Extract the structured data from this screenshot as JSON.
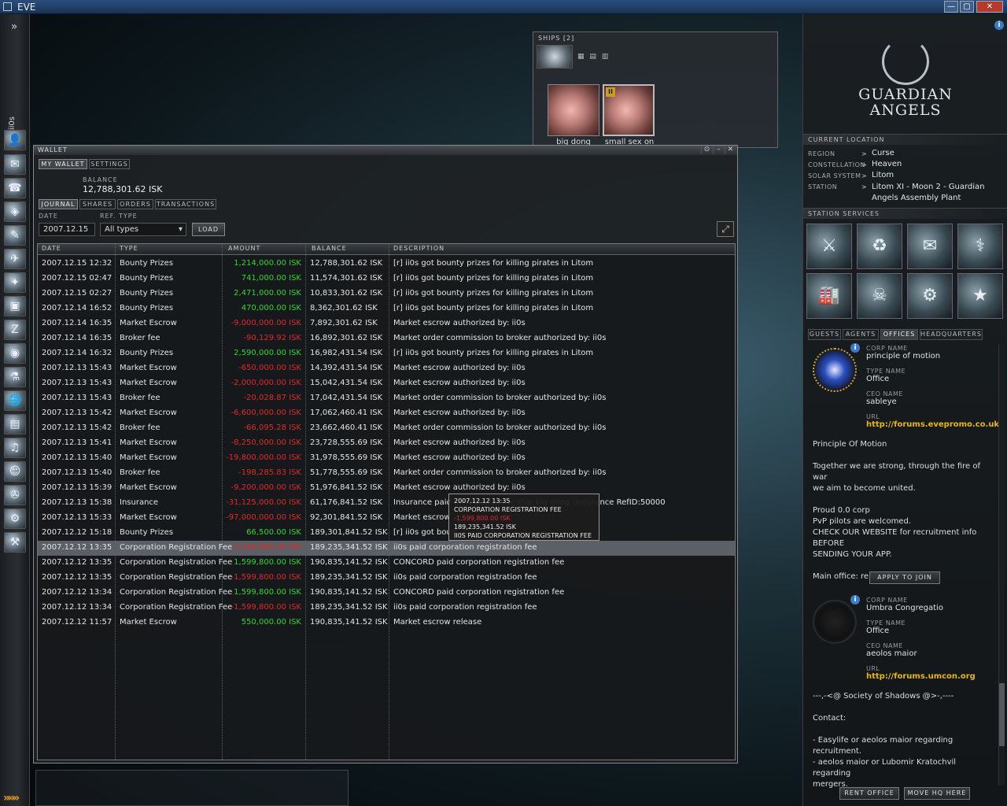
{
  "window": {
    "title": "EVE",
    "min": "—",
    "max": "▢",
    "close": "✕"
  },
  "neocom": {
    "expand_label": "»",
    "username": "ii0s",
    "items": [
      "👤",
      "✉",
      "☎",
      "◈",
      "✎",
      "✈",
      "✦",
      "▣",
      "Z",
      "◉",
      "⚗",
      "🌐",
      "▤",
      "♫",
      "☺",
      "✇",
      "⚙",
      "⚒"
    ],
    "bottom": "»»»"
  },
  "ships": {
    "header": "SHIPS [2]",
    "view_icons": "▦ ▤ ▥",
    "items": [
      {
        "name": "big dong",
        "tag": ""
      },
      {
        "name": "small sex on",
        "tag": "II"
      }
    ]
  },
  "wallet": {
    "title": "WALLET",
    "top_tabs": [
      "MY WALLET",
      "SETTINGS"
    ],
    "balance_label": "BALANCE",
    "balance": "12,788,301.62 ISK",
    "sub_tabs": [
      "JOURNAL",
      "SHARES",
      "ORDERS",
      "TRANSACTIONS"
    ],
    "date_label": "DATE",
    "reftype_label": "REF. TYPE",
    "date_value": "2007.12.15",
    "reftype_value": "All types",
    "load_label": "LOAD",
    "export_icon": "⤢",
    "columns": [
      "DATE",
      "TYPE",
      "AMOUNT",
      "BALANCE",
      "DESCRIPTION"
    ],
    "rows": [
      {
        "date": "2007.12.15 12:32",
        "type": "Bounty Prizes",
        "amount": "1,214,000.00 ISK",
        "sign": "pos",
        "balance": "12,788,301.62 ISK",
        "desc": "[r] ii0s got bounty prizes for killing pirates in Litom"
      },
      {
        "date": "2007.12.15 02:47",
        "type": "Bounty Prizes",
        "amount": "741,000.00 ISK",
        "sign": "pos",
        "balance": "11,574,301.62 ISK",
        "desc": "[r] ii0s got bounty prizes for killing pirates in Litom"
      },
      {
        "date": "2007.12.15 02:27",
        "type": "Bounty Prizes",
        "amount": "2,471,000.00 ISK",
        "sign": "pos",
        "balance": "10,833,301.62 ISK",
        "desc": "[r] ii0s got bounty prizes for killing pirates in Litom"
      },
      {
        "date": "2007.12.14 16:52",
        "type": "Bounty Prizes",
        "amount": "470,000.00 ISK",
        "sign": "pos",
        "balance": "8,362,301.62 ISK",
        "desc": "[r] ii0s got bounty prizes for killing pirates in Litom"
      },
      {
        "date": "2007.12.14 16:35",
        "type": "Market Escrow",
        "amount": "-9,000,000.00 ISK",
        "sign": "neg",
        "balance": "7,892,301.62 ISK",
        "desc": "Market escrow authorized by: ii0s"
      },
      {
        "date": "2007.12.14 16:35",
        "type": "Broker fee",
        "amount": "-90,129.92 ISK",
        "sign": "neg",
        "balance": "16,892,301.62 ISK",
        "desc": "Market order commission to broker authorized by: ii0s"
      },
      {
        "date": "2007.12.14 16:32",
        "type": "Bounty Prizes",
        "amount": "2,590,000.00 ISK",
        "sign": "pos",
        "balance": "16,982,431.54 ISK",
        "desc": "[r] ii0s got bounty prizes for killing pirates in Litom"
      },
      {
        "date": "2007.12.13 15:43",
        "type": "Market Escrow",
        "amount": "-650,000.00 ISK",
        "sign": "neg",
        "balance": "14,392,431.54 ISK",
        "desc": "Market escrow authorized by: ii0s"
      },
      {
        "date": "2007.12.13 15:43",
        "type": "Market Escrow",
        "amount": "-2,000,000.00 ISK",
        "sign": "neg",
        "balance": "15,042,431.54 ISK",
        "desc": "Market escrow authorized by: ii0s"
      },
      {
        "date": "2007.12.13 15:43",
        "type": "Broker fee",
        "amount": "-20,028.87 ISK",
        "sign": "neg",
        "balance": "17,042,431.54 ISK",
        "desc": "Market order commission to broker authorized by: ii0s"
      },
      {
        "date": "2007.12.13 15:42",
        "type": "Market Escrow",
        "amount": "-6,600,000.00 ISK",
        "sign": "neg",
        "balance": "17,062,460.41 ISK",
        "desc": "Market escrow authorized by: ii0s"
      },
      {
        "date": "2007.12.13 15:42",
        "type": "Broker fee",
        "amount": "-66,095.28 ISK",
        "sign": "neg",
        "balance": "23,662,460.41 ISK",
        "desc": "Market order commission to broker authorized by: ii0s"
      },
      {
        "date": "2007.12.13 15:41",
        "type": "Market Escrow",
        "amount": "-8,250,000.00 ISK",
        "sign": "neg",
        "balance": "23,728,555.69 ISK",
        "desc": "Market escrow authorized by: ii0s"
      },
      {
        "date": "2007.12.13 15:40",
        "type": "Market Escrow",
        "amount": "-19,800,000.00 ISK",
        "sign": "neg",
        "balance": "31,978,555.69 ISK",
        "desc": "Market escrow authorized by: ii0s"
      },
      {
        "date": "2007.12.13 15:40",
        "type": "Broker fee",
        "amount": "-198,285.83 ISK",
        "sign": "neg",
        "balance": "51,778,555.69 ISK",
        "desc": "Market order commission to broker authorized by: ii0s"
      },
      {
        "date": "2007.12.13 15:39",
        "type": "Market Escrow",
        "amount": "-9,200,000.00 ISK",
        "sign": "neg",
        "balance": "51,976,841.52 ISK",
        "desc": "Market escrow authorized by: ii0s"
      },
      {
        "date": "2007.12.13 15:38",
        "type": "Insurance",
        "amount": "-31,125,000.00 ISK",
        "sign": "neg",
        "balance": "61,176,841.52 ISK",
        "desc": "Insurance paid                                                  commission for ship big dong (Insurance RefID:50000"
      },
      {
        "date": "2007.12.13 15:33",
        "type": "Market Escrow",
        "amount": "-97,000,000.00 ISK",
        "sign": "neg",
        "balance": "92,301,841.52 ISK",
        "desc": "Market escrow"
      },
      {
        "date": "2007.12.12 15:18",
        "type": "Bounty Prizes",
        "amount": "66,500.00 ISK",
        "sign": "pos",
        "balance": "189,301,841.52 ISK",
        "desc": "[r] ii0s got boun"
      },
      {
        "date": "2007.12.12 13:35",
        "type": "Corporation Registration Fee",
        "amount": "-1,599,800.00 ISK",
        "sign": "neg",
        "balance": "189,235,341.52 ISK",
        "desc": "ii0s paid corporation registration fee",
        "selected": true
      },
      {
        "date": "2007.12.12 13:35",
        "type": "Corporation Registration Fee",
        "amount": "1,599,800.00 ISK",
        "sign": "pos",
        "balance": "190,835,141.52 ISK",
        "desc": "CONCORD paid corporation registration fee"
      },
      {
        "date": "2007.12.12 13:35",
        "type": "Corporation Registration Fee",
        "amount": "-1,599,800.00 ISK",
        "sign": "neg",
        "balance": "189,235,341.52 ISK",
        "desc": "ii0s paid corporation registration fee"
      },
      {
        "date": "2007.12.12 13:34",
        "type": "Corporation Registration Fee",
        "amount": "1,599,800.00 ISK",
        "sign": "pos",
        "balance": "190,835,141.52 ISK",
        "desc": "CONCORD paid corporation registration fee"
      },
      {
        "date": "2007.12.12 13:34",
        "type": "Corporation Registration Fee",
        "amount": "-1,599,800.00 ISK",
        "sign": "neg",
        "balance": "189,235,341.52 ISK",
        "desc": "ii0s paid corporation registration fee"
      },
      {
        "date": "2007.12.12 11:57",
        "type": "Market Escrow",
        "amount": "550,000.00 ISK",
        "sign": "pos",
        "balance": "190,835,141.52 ISK",
        "desc": "Market escrow release"
      }
    ],
    "tooltip": {
      "date": "2007.12.12  13:35",
      "type": "CORPORATION REGISTRATION FEE",
      "amount": "-1,599,800.00 ISK",
      "balance": "189,235,341.52 ISK",
      "desc": "II0S PAID CORPORATION REGISTRATION FEE"
    }
  },
  "station": {
    "logo_line1": "GUARDIAN",
    "logo_line2": "ANGELS",
    "current_location_label": "CURRENT LOCATION",
    "location": [
      {
        "label": "REGION",
        "value": "Curse"
      },
      {
        "label": "CONSTELLATION",
        "value": "Heaven"
      },
      {
        "label": "SOLAR SYSTEM",
        "value": "Litom"
      },
      {
        "label": "STATION",
        "value": "Litom XI - Moon 2 - Guardian\nAngels Assembly Plant"
      }
    ],
    "services_label": "STATION SERVICES",
    "services": [
      "⚔",
      "♻",
      "✉",
      "⚕",
      "🏭",
      "☠",
      "⚙",
      "★"
    ],
    "tabs": [
      "GUESTS",
      "AGENTS",
      "OFFICES",
      "HEADQUARTERS"
    ],
    "offices": [
      {
        "corp_label": "CORP NAME",
        "corp": "principle of motion",
        "type_label": "TYPE NAME",
        "type": "Office",
        "ceo_label": "CEO NAME",
        "ceo": "sableye",
        "url_label": "URL",
        "url": "http://forums.evepromo.co.uk/ind",
        "description": "Principle Of Motion\n\nTogether we are strong, through the fire of war\nwe aim to become united.\n\nProud 0.0 corp\nPvP pilots are welcomed.\nCHECK OUR WEBSITE for recruitment info BEFORE\nSENDING YOUR APP.\n\nMain office: renyn - f...",
        "apply_label": "APPLY TO JOIN"
      },
      {
        "corp_label": "CORP NAME",
        "corp": "Umbra Congregatio",
        "type_label": "TYPE NAME",
        "type": "Office",
        "ceo_label": "CEO NAME",
        "ceo": "aeolos maior",
        "url_label": "URL",
        "url": "http://forums.umcon.org",
        "description": "---,-<@ Society of Shadows @>-,----\n\nContact:\n\n- Easylife or aeolos maior regarding recruitment.\n- aeolos maior or Lubomir Kratochvil regarding\nmergers.\n\nPublic Channel: UMCON"
      }
    ],
    "rent_office": "RENT OFFICE",
    "move_hq": "MOVE HQ HERE"
  }
}
